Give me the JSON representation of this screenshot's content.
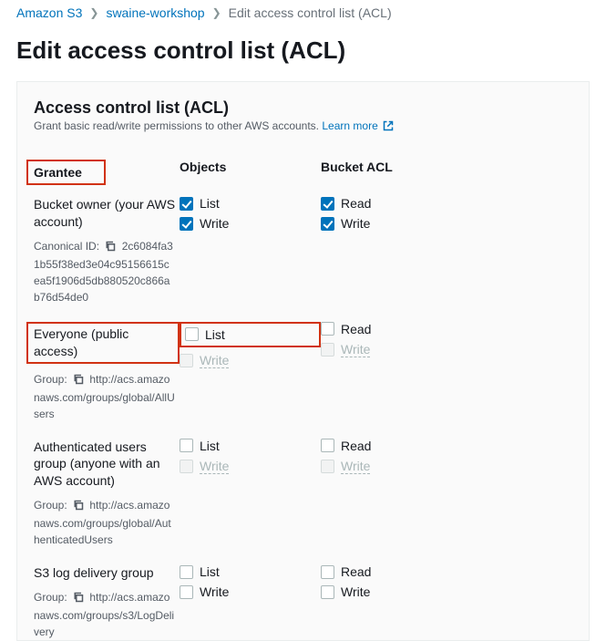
{
  "breadcrumb": {
    "root": "Amazon S3",
    "bucket": "swaine-workshop",
    "current": "Edit access control list (ACL)"
  },
  "page_title": "Edit access control list (ACL)",
  "panel": {
    "title": "Access control list (ACL)",
    "desc": "Grant basic read/write permissions to other AWS accounts.",
    "learn_more": "Learn more"
  },
  "columns": {
    "grantee": "Grantee",
    "objects": "Objects",
    "bucket_acl": "Bucket ACL"
  },
  "labels": {
    "list": "List",
    "write": "Write",
    "read": "Read",
    "canonical_id": "Canonical ID:",
    "group": "Group:"
  },
  "grantees": {
    "owner": {
      "name": "Bucket owner (your AWS account)",
      "canonical_id": "2c6084fa31b55f38ed3e04c95156615cea5f1906d5db880520c866ab76d54de0"
    },
    "everyone": {
      "name": "Everyone (public access)",
      "group_url": "http://acs.amazonaws.com/groups/global/AllUsers"
    },
    "auth": {
      "name": "Authenticated users group (anyone with an AWS account)",
      "group_url": "http://acs.amazonaws.com/groups/global/AuthenticatedUsers"
    },
    "log": {
      "name": "S3 log delivery group",
      "group_url": "http://acs.amazonaws.com/groups/s3/LogDelivery"
    }
  }
}
